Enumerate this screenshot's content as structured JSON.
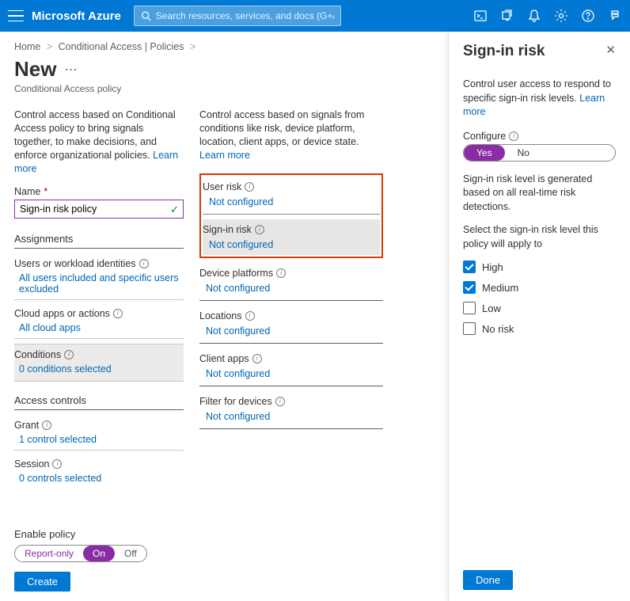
{
  "header": {
    "brand": "Microsoft Azure",
    "search_placeholder": "Search resources, services, and docs (G+/)"
  },
  "breadcrumb": {
    "home": "Home",
    "parent": "Conditional Access | Policies"
  },
  "page": {
    "title": "New",
    "subtitle": "Conditional Access policy"
  },
  "colA": {
    "intro": "Control access based on Conditional Access policy to bring signals together, to make decisions, and enforce organizational policies.",
    "learn_more": "Learn more",
    "name_label": "Name",
    "name_value": "Sign-in risk policy",
    "assignments_heading": "Assignments",
    "users_label": "Users or workload identities",
    "users_value": "All users included and specific users excluded",
    "cloud_label": "Cloud apps or actions",
    "cloud_value": "All cloud apps",
    "cond_label": "Conditions",
    "cond_value": "0 conditions selected",
    "access_heading": "Access controls",
    "grant_label": "Grant",
    "grant_value": "1 control selected",
    "session_label": "Session",
    "session_value": "0 controls selected"
  },
  "colB": {
    "intro": "Control access based on signals from conditions like risk, device platform, location, client apps, or device state.",
    "learn_more": "Learn more",
    "user_risk_label": "User risk",
    "user_risk_value": "Not configured",
    "signin_risk_label": "Sign-in risk",
    "signin_risk_value": "Not configured",
    "device_label": "Device platforms",
    "device_value": "Not configured",
    "locations_label": "Locations",
    "locations_value": "Not configured",
    "client_label": "Client apps",
    "client_value": "Not configured",
    "filter_label": "Filter for devices",
    "filter_value": "Not configured"
  },
  "footer": {
    "enable_label": "Enable policy",
    "opt1": "Report-only",
    "opt2": "On",
    "opt3": "Off",
    "create": "Create"
  },
  "panel": {
    "title": "Sign-in risk",
    "desc1": "Control user access to respond to specific sign-in risk levels.",
    "learn_more": "Learn more",
    "configure_label": "Configure",
    "yes": "Yes",
    "no": "No",
    "desc2": "Sign-in risk level is generated based on all real-time risk detections.",
    "desc3": "Select the sign-in risk level this policy will apply to",
    "high": "High",
    "medium": "Medium",
    "low": "Low",
    "norisk": "No risk",
    "done": "Done"
  }
}
